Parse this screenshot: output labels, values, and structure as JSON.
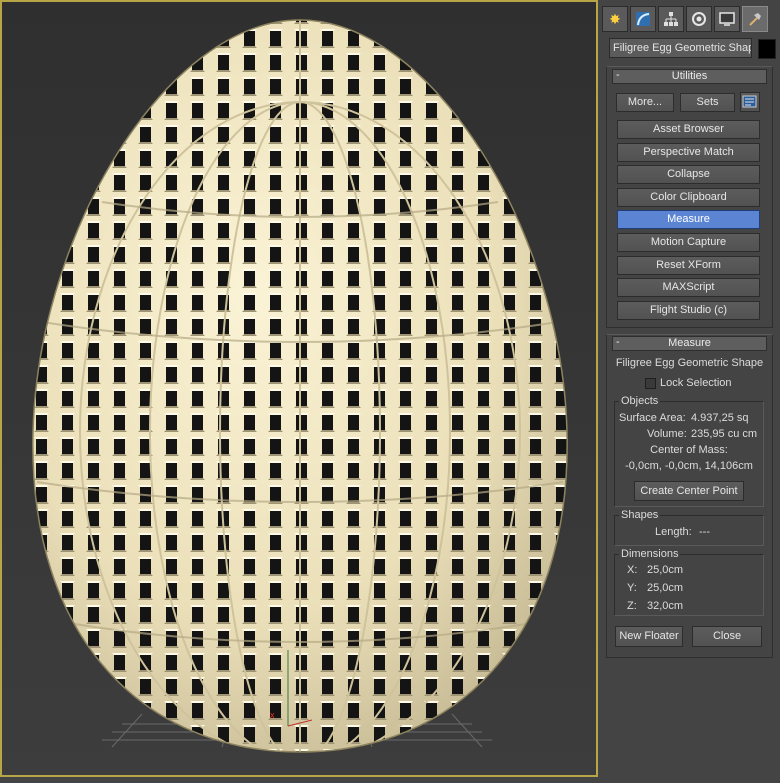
{
  "command_panel": {
    "tabs": [
      {
        "name": "create",
        "icon": "sun-icon"
      },
      {
        "name": "modify",
        "icon": "modify-arc-icon"
      },
      {
        "name": "hierarchy",
        "icon": "hierarchy-icon"
      },
      {
        "name": "motion",
        "icon": "motion-circle-icon"
      },
      {
        "name": "display",
        "icon": "display-monitor-icon"
      },
      {
        "name": "utilities",
        "icon": "hammer-icon"
      }
    ],
    "object_name": "Filigree Egg Geometric Shape",
    "object_color": "#000000"
  },
  "utilities": {
    "title": "Utilities",
    "collapse_symbol": "-",
    "more_label": "More...",
    "sets_label": "Sets",
    "configure_icon": "configure-sets-icon",
    "items": [
      {
        "label": "Asset Browser",
        "selected": false
      },
      {
        "label": "Perspective Match",
        "selected": false
      },
      {
        "label": "Collapse",
        "selected": false
      },
      {
        "label": "Color Clipboard",
        "selected": false
      },
      {
        "label": "Measure",
        "selected": true
      },
      {
        "label": "Motion Capture",
        "selected": false
      },
      {
        "label": "Reset XForm",
        "selected": false
      },
      {
        "label": "MAXScript",
        "selected": false
      },
      {
        "label": "Flight Studio (c)",
        "selected": false
      }
    ],
    "selected_color": "#5b85d3"
  },
  "measure": {
    "title": "Measure",
    "collapse_symbol": "-",
    "object_name": "Filigree Egg Geometric Shape",
    "lock_selection_label": "Lock Selection",
    "lock_selection_checked": false,
    "objects_group": {
      "title": "Objects",
      "surface_area_label": "Surface Area:",
      "surface_area_value": "4.937,25 sq",
      "volume_label": "Volume:",
      "volume_value": "235,95 cu cm",
      "center_of_mass_label": "Center of Mass:",
      "center_of_mass_value": "-0,0cm, -0,0cm, 14,106cm",
      "create_center_point_label": "Create Center Point"
    },
    "shapes_group": {
      "title": "Shapes",
      "length_label": "Length:",
      "length_value": "---"
    },
    "dimensions_group": {
      "title": "Dimensions",
      "x_label": "X:",
      "x_value": "25,0cm",
      "y_label": "Y:",
      "y_value": "25,0cm",
      "z_label": "Z:",
      "z_value": "32,0cm"
    },
    "new_floater_label": "New Floater",
    "close_label": "Close"
  },
  "viewport": {
    "active_border_color": "#b8a646",
    "object_color": "#f2e6bf"
  }
}
